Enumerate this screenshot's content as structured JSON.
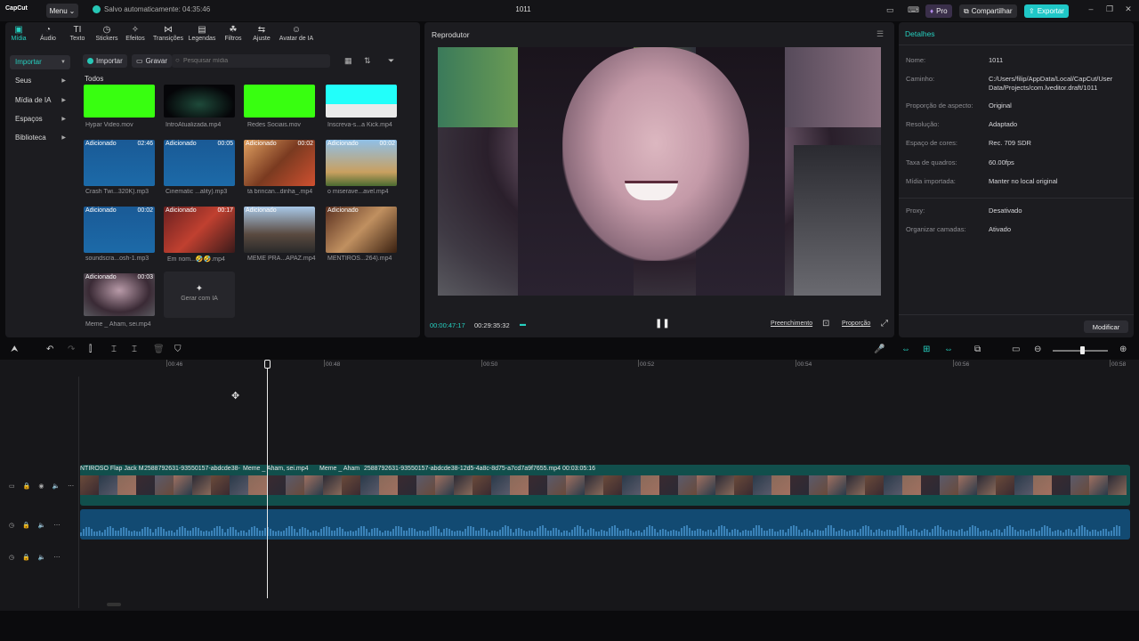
{
  "app": {
    "logo": "CapCut",
    "menu_label": "Menu",
    "save_status": "Salvo automaticamente: 04:35:46",
    "project_title": "1011",
    "pro_label": "Pro",
    "share_label": "Compartilhar",
    "export_label": "Exportar"
  },
  "media_tabs": [
    {
      "label": "Mídia",
      "icon": "media-icon"
    },
    {
      "label": "Áudio",
      "icon": "audio-icon"
    },
    {
      "label": "Texto",
      "icon": "text-icon"
    },
    {
      "label": "Stickers",
      "icon": "sticker-icon"
    },
    {
      "label": "Efeitos",
      "icon": "effects-icon"
    },
    {
      "label": "Transições",
      "icon": "transitions-icon"
    },
    {
      "label": "Legendas",
      "icon": "captions-icon"
    },
    {
      "label": "Filtros",
      "icon": "filters-icon"
    },
    {
      "label": "Ajuste",
      "icon": "adjust-icon"
    },
    {
      "label": "Avatar de IA",
      "icon": "avatar-icon"
    }
  ],
  "sidebar": {
    "items": [
      {
        "label": "Importar"
      },
      {
        "label": "Seus"
      },
      {
        "label": "Mídia de IA"
      },
      {
        "label": "Espaços"
      },
      {
        "label": "Biblioteca"
      }
    ]
  },
  "media_toolbar": {
    "import_label": "Importar",
    "record_label": "Gravar",
    "search_placeholder": "Pesquisar mídia"
  },
  "media_section_title": "Todos",
  "media_items": [
    {
      "name": "Hypar Video.mov",
      "badge": "",
      "duration": ""
    },
    {
      "name": "IntroAtualizada.mp4",
      "badge": "",
      "duration": ""
    },
    {
      "name": "Redes Sociais.mov",
      "badge": "",
      "duration": ""
    },
    {
      "name": "Inscreva-s...a Kick.mp4",
      "badge": "",
      "duration": ""
    },
    {
      "name": "Crash Twi...320K).mp3",
      "badge": "Adicionado",
      "duration": "02:46"
    },
    {
      "name": "Cinematic ...ality).mp3",
      "badge": "Adicionado",
      "duration": "00:05"
    },
    {
      "name": "tá brincan...dinha_.mp4",
      "badge": "Adicionado",
      "duration": "00:02"
    },
    {
      "name": "o miserave...avel.mp4",
      "badge": "Adicionado",
      "duration": "00:02"
    },
    {
      "name": "soundscra...osh-1.mp3",
      "badge": "Adicionado",
      "duration": "00:02"
    },
    {
      "name": "Em nom...🤣🤣.mp4",
      "badge": "Adicionado",
      "duration": "00:17"
    },
    {
      "name": "MEME PRA...APAZ.mp4",
      "badge": "Adicionado",
      "duration": ""
    },
    {
      "name": "MENTIROS...264).mp4",
      "badge": "Adicionado",
      "duration": ""
    },
    {
      "name": "Meme _ Aham, sei.mp4",
      "badge": "Adicionado",
      "duration": "00:03"
    }
  ],
  "generate_ai_label": "Gerar com IA",
  "player": {
    "title": "Reprodutor",
    "time_current": "00:00:47:17",
    "time_total": "00:29:35:32",
    "fill_label": "Preenchimento",
    "ratio_label": "Proporção"
  },
  "details": {
    "title": "Detalhes",
    "rows": [
      {
        "key": "Nome:",
        "value": "1011"
      },
      {
        "key": "Caminho:",
        "value": "C:/Users/filip/AppData/Local/CapCut/User Data/Projects/com.lveditor.draft/1011"
      },
      {
        "key": "Proporção de aspecto:",
        "value": "Original"
      },
      {
        "key": "Resolução:",
        "value": "Adaptado"
      },
      {
        "key": "Espaço de cores:",
        "value": "Rec. 709 SDR"
      },
      {
        "key": "Taxa de quadros:",
        "value": "60.00fps"
      },
      {
        "key": "Mídia importada:",
        "value": "Manter no local original"
      },
      {
        "key": "Proxy:",
        "value": "Desativado"
      },
      {
        "key": "Organizar camadas:",
        "value": "Ativado"
      }
    ],
    "modify_label": "Modificar"
  },
  "timeline": {
    "ruler": [
      "00:46",
      "00:48",
      "00:50",
      "00:52",
      "00:54",
      "00:56",
      "00:58"
    ],
    "clips": [
      {
        "title": "NTIROSO Flap Jack M"
      },
      {
        "title": "2588792631-93550157-abdcde38-"
      },
      {
        "title": "Meme _ Aham, sei.mp4"
      },
      {
        "title": "Meme _ Aham"
      },
      {
        "title": "2588792631-93550157-abdcde38-12d5-4a8c-8d75-a7cd7a9f7655.mp4   00:03:05:16"
      }
    ]
  },
  "colors": {
    "accent": "#26d0c0",
    "video_track": "#114f4c",
    "audio_track": "#124a72"
  }
}
